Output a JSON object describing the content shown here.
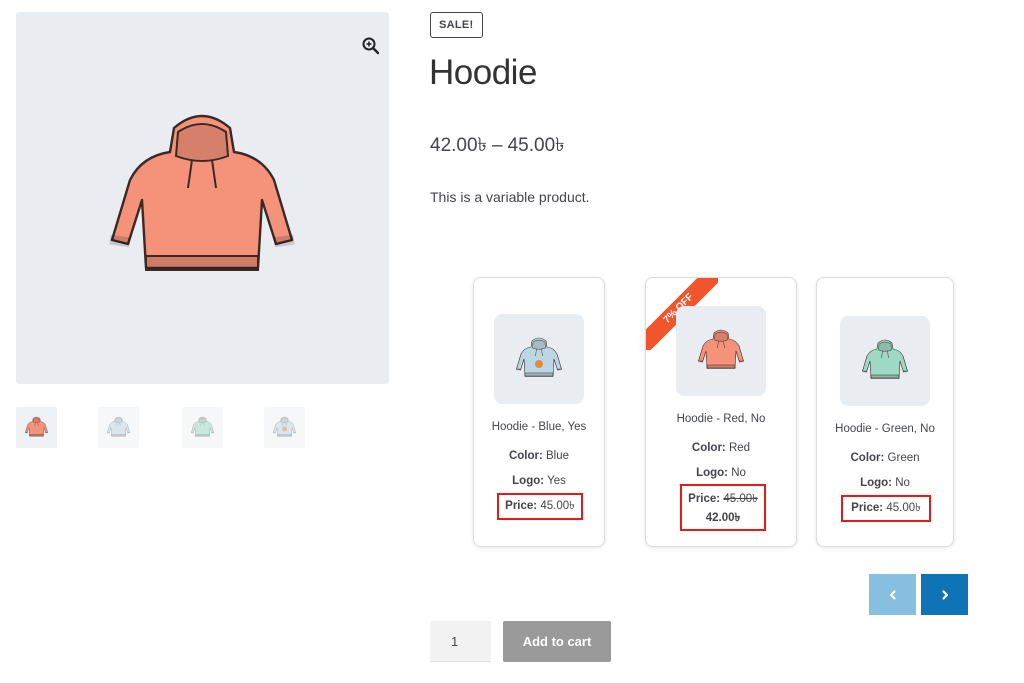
{
  "product": {
    "sale_badge": "SALE!",
    "title": "Hoodie",
    "price_min": "42.00৳",
    "price_sep": "–",
    "price_max": "45.00৳",
    "description": "This is a variable product."
  },
  "gallery": {
    "zoom_icon": "zoom-in-icon",
    "main_color": "#f28b73",
    "thumbnails": [
      {
        "color": "coral"
      },
      {
        "color": "light-blue"
      },
      {
        "color": "mint"
      },
      {
        "color": "light-blue-logo"
      }
    ]
  },
  "variations": [
    {
      "name": "Hoodie - Blue, Yes",
      "color_label": "Color:",
      "color_value": "Blue",
      "logo_label": "Logo:",
      "logo_value": "Yes",
      "price_label": "Price:",
      "price": "45.00৳"
    },
    {
      "name": "Hoodie - Red, No",
      "ribbon": "7% OFF",
      "color_label": "Color:",
      "color_value": "Red",
      "logo_label": "Logo:",
      "logo_value": "No",
      "price_label": "Price:",
      "price_old": "45.00৳",
      "price": "42.00৳"
    },
    {
      "name": "Hoodie - Green, No",
      "color_label": "Color:",
      "color_value": "Green",
      "logo_label": "Logo:",
      "logo_value": "No",
      "price_label": "Price:",
      "price": "45.00৳"
    }
  ],
  "carousel": {
    "prev_icon": "chevron-left-icon",
    "next_icon": "chevron-right-icon"
  },
  "cart": {
    "quantity": "1",
    "add_to_cart": "Add to cart"
  },
  "colors": {
    "accent_blue": "#0f74b6",
    "accent_blue_light": "#86bfdf",
    "highlight_red": "#e51b1b",
    "ribbon_orange": "#f1552b",
    "button_gray": "#9a9a9a"
  }
}
